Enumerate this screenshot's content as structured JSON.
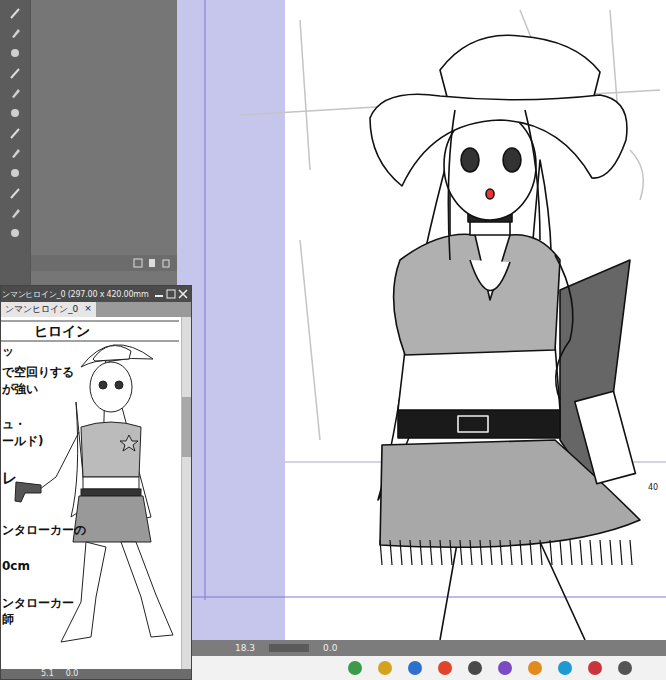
{
  "reference_window": {
    "title": "ンマンヒロイン_0 (297.00 x 420.00mm",
    "tab": {
      "label": "ンマンヒロイン_0",
      "close": "×",
      "selected": true
    },
    "sheet": {
      "heading": "ヒロイン",
      "lines": [
        "ッ",
        "で空回りする",
        "が強い",
        "ュ・",
        "ールド)",
        "レ",
        "ンタローカーの",
        "0cm",
        "ンタローカー",
        "師"
      ]
    },
    "status": {
      "zoom": "5.1",
      "angle": "0.0"
    }
  },
  "canvas": {
    "page_number": "40",
    "status": {
      "zoom": "18.3",
      "angle": "0.0"
    }
  }
}
